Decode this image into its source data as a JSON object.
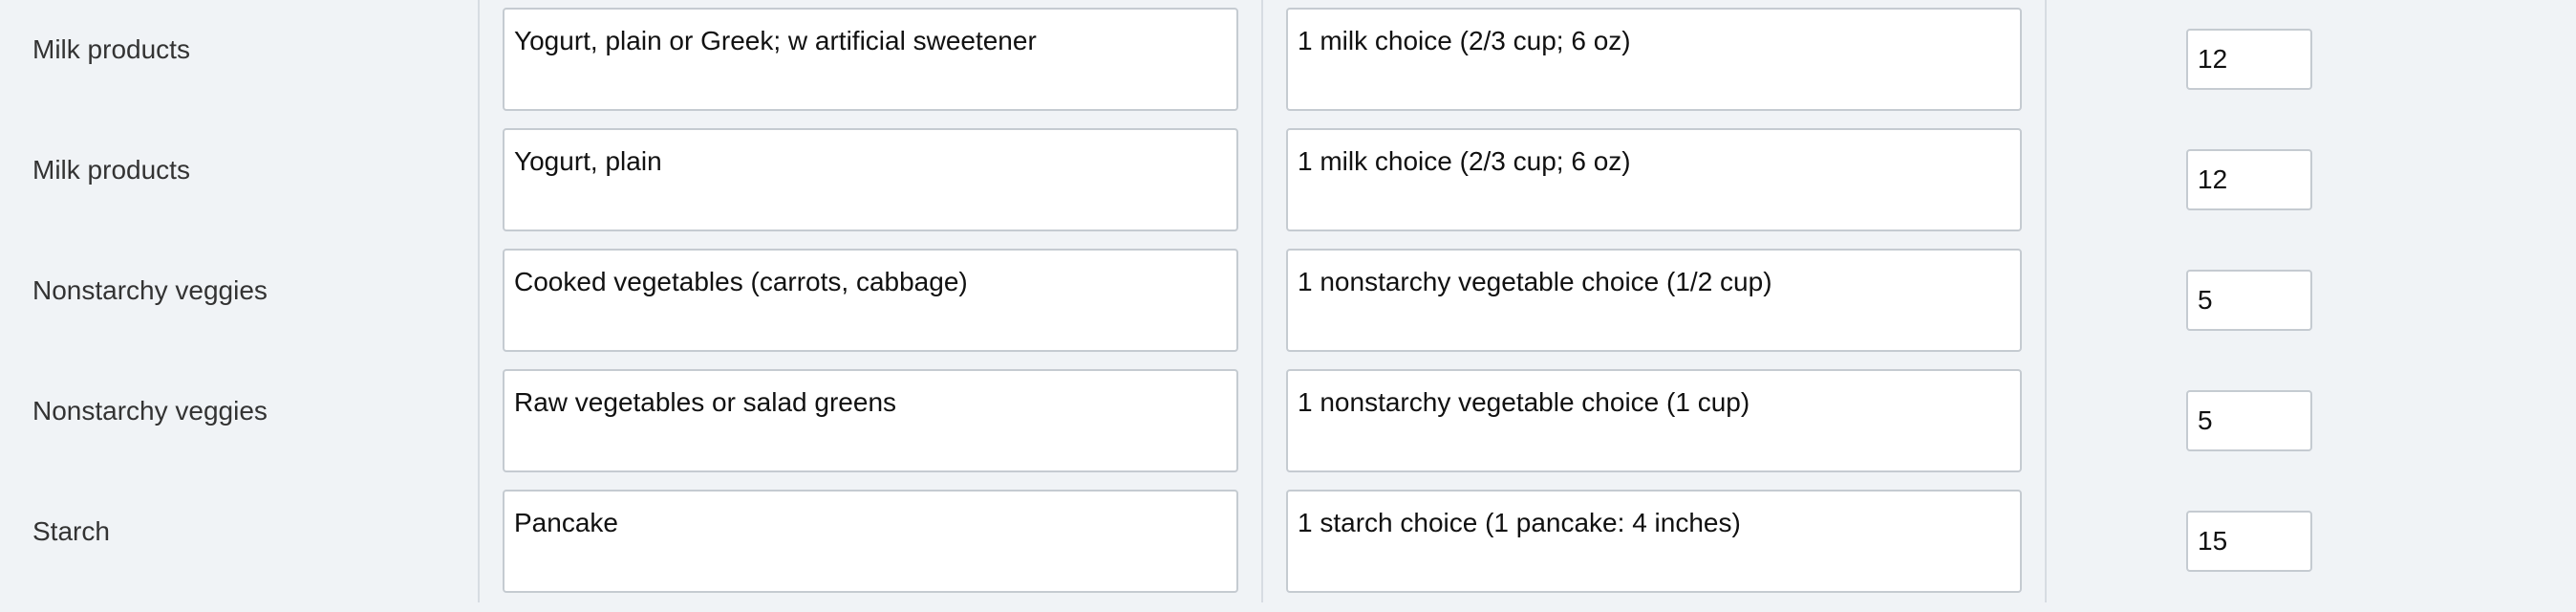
{
  "rows": [
    {
      "category": "Milk products",
      "food": "Yogurt, plain or Greek; w artificial sweetener",
      "serving": "1 milk choice (2/3 cup; 6 oz)",
      "value": "12"
    },
    {
      "category": "Milk products",
      "food": "Yogurt, plain",
      "serving": "1 milk choice (2/3 cup; 6 oz)",
      "value": "12"
    },
    {
      "category": "Nonstarchy veggies",
      "food": "Cooked vegetables (carrots, cabbage)",
      "serving": "1 nonstarchy vegetable choice (1/2 cup)",
      "value": "5"
    },
    {
      "category": "Nonstarchy veggies",
      "food": "Raw vegetables or salad greens",
      "serving": "1 nonstarchy vegetable choice (1 cup)",
      "value": "5"
    },
    {
      "category": "Starch",
      "food": "Pancake",
      "serving": "1 starch choice (1 pancake: 4 inches)",
      "value": "15"
    }
  ]
}
